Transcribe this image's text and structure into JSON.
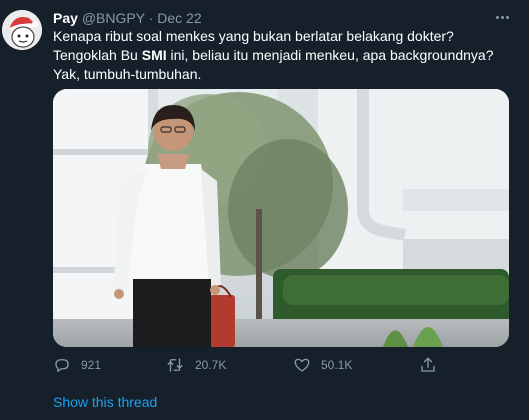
{
  "tweet": {
    "author_name": "Pay",
    "author_handle": "@BNGPY",
    "separator": "·",
    "date": "Dec 22",
    "text_before_bold": "Kenapa ribut soal menkes yang bukan berlatar belakang dokter? Tengoklah Bu ",
    "text_bold": "SMI",
    "text_after_bold": " ini, beliau itu menjadi menkeu, apa backgroundnya? Yak, tumbuh-tumbuhan.",
    "reply_count": "921",
    "retweet_count": "20.7K",
    "like_count": "50.1K",
    "show_thread": "Show this thread"
  },
  "icons": {
    "reply": "reply-icon",
    "retweet": "retweet-icon",
    "like": "heart-icon",
    "share": "share-icon",
    "more": "more-icon"
  },
  "colors": {
    "background": "#15202b",
    "secondary_text": "#8899a6",
    "link": "#1da1f2"
  }
}
